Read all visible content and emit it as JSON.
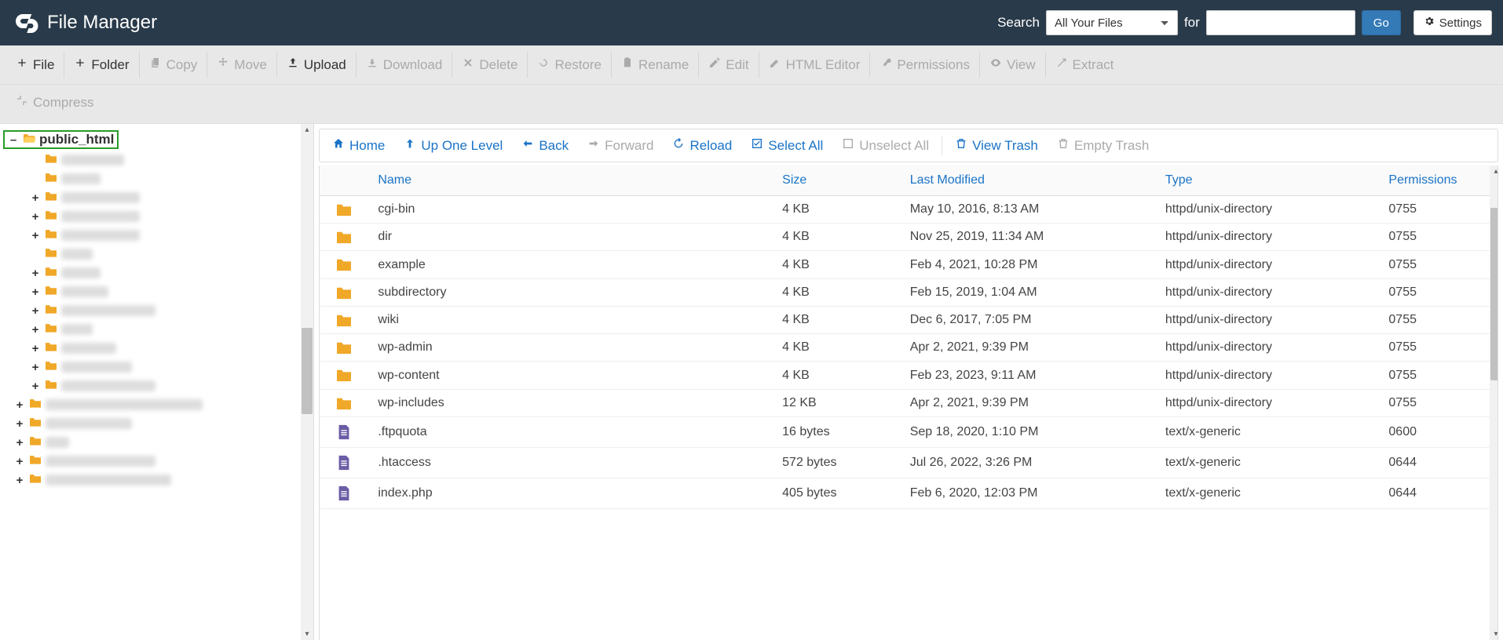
{
  "header": {
    "title": "File Manager",
    "search_label": "Search",
    "search_select": "All Your Files",
    "for_label": "for",
    "go_label": "Go",
    "settings_label": "Settings"
  },
  "toolbar": {
    "file": "File",
    "folder": "Folder",
    "copy": "Copy",
    "move": "Move",
    "upload": "Upload",
    "download": "Download",
    "delete": "Delete",
    "restore": "Restore",
    "rename": "Rename",
    "edit": "Edit",
    "html_editor": "HTML Editor",
    "permissions": "Permissions",
    "view": "View",
    "extract": "Extract",
    "compress": "Compress"
  },
  "tree": {
    "root": "public_html"
  },
  "actionbar": {
    "home": "Home",
    "up": "Up One Level",
    "back": "Back",
    "forward": "Forward",
    "reload": "Reload",
    "select_all": "Select All",
    "unselect_all": "Unselect All",
    "view_trash": "View Trash",
    "empty_trash": "Empty Trash"
  },
  "columns": {
    "name": "Name",
    "size": "Size",
    "modified": "Last Modified",
    "type": "Type",
    "permissions": "Permissions"
  },
  "files": [
    {
      "icon": "folder",
      "name": "cgi-bin",
      "size": "4 KB",
      "modified": "May 10, 2016, 8:13 AM",
      "type": "httpd/unix-directory",
      "perm": "0755"
    },
    {
      "icon": "folder",
      "name": "dir",
      "size": "4 KB",
      "modified": "Nov 25, 2019, 11:34 AM",
      "type": "httpd/unix-directory",
      "perm": "0755"
    },
    {
      "icon": "folder",
      "name": "example",
      "size": "4 KB",
      "modified": "Feb 4, 2021, 10:28 PM",
      "type": "httpd/unix-directory",
      "perm": "0755"
    },
    {
      "icon": "folder",
      "name": "subdirectory",
      "size": "4 KB",
      "modified": "Feb 15, 2019, 1:04 AM",
      "type": "httpd/unix-directory",
      "perm": "0755"
    },
    {
      "icon": "folder",
      "name": "wiki",
      "size": "4 KB",
      "modified": "Dec 6, 2017, 7:05 PM",
      "type": "httpd/unix-directory",
      "perm": "0755"
    },
    {
      "icon": "folder",
      "name": "wp-admin",
      "size": "4 KB",
      "modified": "Apr 2, 2021, 9:39 PM",
      "type": "httpd/unix-directory",
      "perm": "0755"
    },
    {
      "icon": "folder",
      "name": "wp-content",
      "size": "4 KB",
      "modified": "Feb 23, 2023, 9:11 AM",
      "type": "httpd/unix-directory",
      "perm": "0755"
    },
    {
      "icon": "folder",
      "name": "wp-includes",
      "size": "12 KB",
      "modified": "Apr 2, 2021, 9:39 PM",
      "type": "httpd/unix-directory",
      "perm": "0755"
    },
    {
      "icon": "doc",
      "name": ".ftpquota",
      "size": "16 bytes",
      "modified": "Sep 18, 2020, 1:10 PM",
      "type": "text/x-generic",
      "perm": "0600"
    },
    {
      "icon": "doc",
      "name": ".htaccess",
      "size": "572 bytes",
      "modified": "Jul 26, 2022, 3:26 PM",
      "type": "text/x-generic",
      "perm": "0644"
    },
    {
      "icon": "doc",
      "name": "index.php",
      "size": "405 bytes",
      "modified": "Feb 6, 2020, 12:03 PM",
      "type": "text/x-generic",
      "perm": "0644"
    }
  ]
}
